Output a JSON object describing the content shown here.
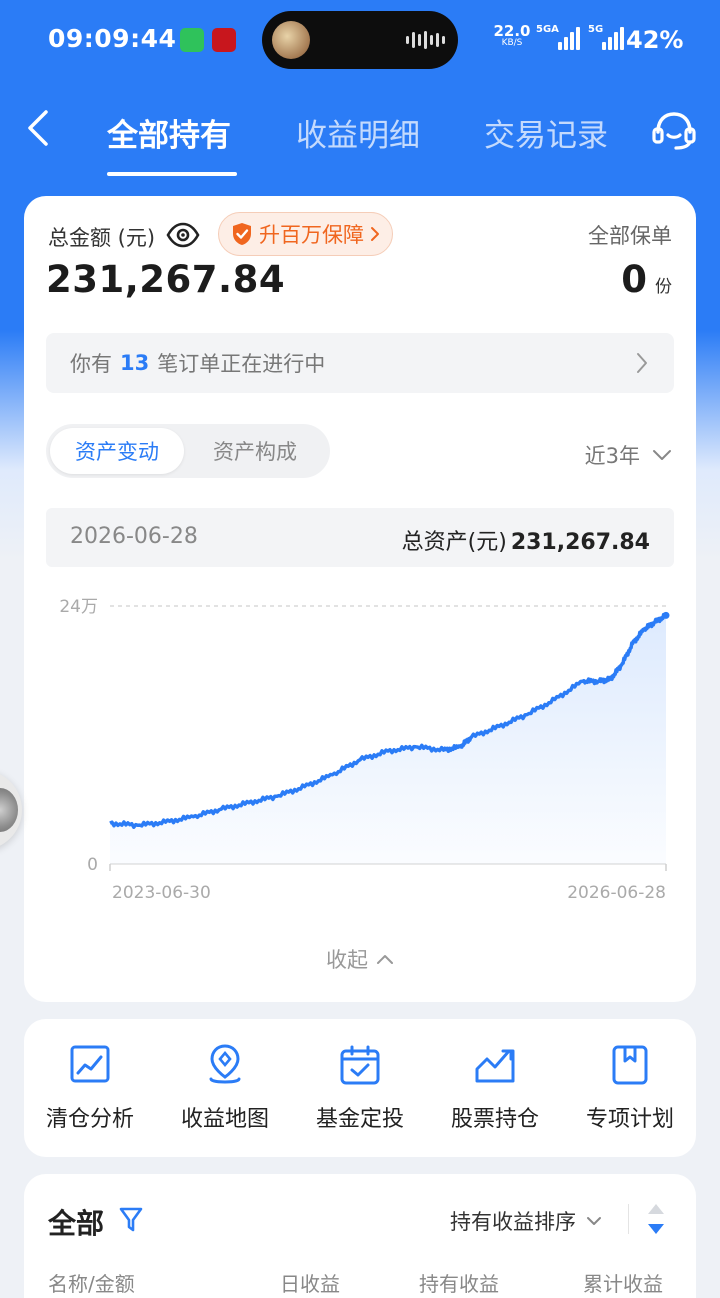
{
  "status_bar": {
    "time": "09:09:44",
    "net_speed_value": "22.0",
    "net_speed_unit": "KB/S",
    "sim1_label": "5GA",
    "sim2_label": "5G",
    "battery": "42%"
  },
  "nav": {
    "tabs": [
      {
        "label": "全部持有",
        "active": true
      },
      {
        "label": "收益明细",
        "active": false
      },
      {
        "label": "交易记录",
        "active": false
      }
    ]
  },
  "summary": {
    "total_label": "总金额 (元)",
    "promo_label": "升百万保障",
    "total_value": "231,267.84",
    "policy_label": "全部保单",
    "policy_count": "0",
    "policy_unit": "份",
    "orders_prefix": "你有",
    "orders_count": "13",
    "orders_suffix": "笔订单正在进行中"
  },
  "asset_panel": {
    "segments": [
      "资产变动",
      "资产构成"
    ],
    "range": "近3年",
    "info_date": "2026-06-28",
    "info_total_label": "总资产(元)",
    "info_total_value": "231,267.84",
    "collapse_label": "收起"
  },
  "chart_data": {
    "type": "area",
    "y_tick_labels": [
      "24万",
      "0"
    ],
    "ylim": [
      0,
      240000
    ],
    "x_tick_labels": [
      "2023-06-30",
      "2026-06-28"
    ],
    "series_color": "#2b7cf6",
    "x": [
      0,
      0.05,
      0.1,
      0.15,
      0.2,
      0.25,
      0.3,
      0.35,
      0.4,
      0.45,
      0.5,
      0.55,
      0.6,
      0.63,
      0.65,
      0.7,
      0.75,
      0.8,
      0.85,
      0.88,
      0.9,
      0.92,
      0.94,
      0.96,
      0.98,
      1.0
    ],
    "values": [
      38000,
      36000,
      39000,
      44000,
      51000,
      57000,
      63000,
      72000,
      83000,
      97000,
      105000,
      109000,
      106000,
      109000,
      118000,
      128000,
      139000,
      153000,
      170000,
      170000,
      172000,
      185000,
      205000,
      218000,
      225000,
      231268
    ]
  },
  "tools": [
    {
      "label": "清仓分析",
      "icon": "clearance-chart-icon"
    },
    {
      "label": "收益地图",
      "icon": "map-pin-icon"
    },
    {
      "label": "基金定投",
      "icon": "calendar-check-icon"
    },
    {
      "label": "股票持仓",
      "icon": "stock-trend-icon"
    },
    {
      "label": "专项计划",
      "icon": "bookmark-book-icon"
    }
  ],
  "holdings": {
    "title": "全部",
    "sort_label": "持有收益排序",
    "columns": [
      "名称/金额",
      "日收益",
      "持有收益",
      "累计收益"
    ]
  },
  "colors": {
    "brand_blue": "#2b7cf6",
    "promo_orange": "#f0661f"
  }
}
